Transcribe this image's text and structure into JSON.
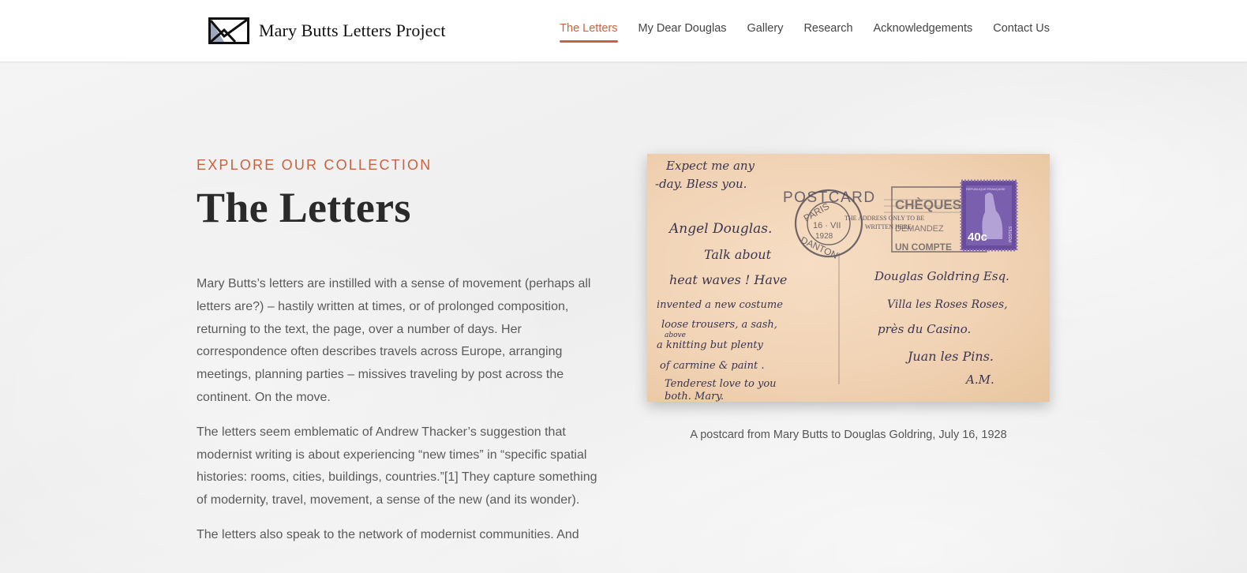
{
  "site": {
    "title": "Mary Butts Letters Project"
  },
  "nav": {
    "items": [
      {
        "label": "The Letters",
        "active": true
      },
      {
        "label": "My Dear Douglas",
        "active": false
      },
      {
        "label": "Gallery",
        "active": false
      },
      {
        "label": "Research",
        "active": false
      },
      {
        "label": "Acknowledgements",
        "active": false
      },
      {
        "label": "Contact Us",
        "active": false
      }
    ]
  },
  "hero": {
    "eyebrow": "EXPLORE OUR COLLECTION",
    "title": "The Letters",
    "paragraphs": [
      "Mary Butts’s letters are instilled with a sense of movement (perhaps all letters are?) – hastily written at times, or of prolonged composition, returning to the text, the page, over a number of days. Her correspondence often describes travels across Europe, arranging meetings, planning parties – missives traveling by post across the continent. On the move.",
      "The letters seem emblematic of Andrew Thacker’s suggestion that modernist writing is about experiencing “new times” in “specific spatial histories: rooms, cities, buildings, countries.”[1] They capture something of modernity, travel, movement, a sense of the new (and its wonder).",
      "The letters also speak to the network of modernist communities. And"
    ]
  },
  "figure": {
    "caption": "A postcard from Mary Butts to Douglas Goldring, July 16, 1928",
    "postcard": {
      "header": "POSTCARD",
      "address_note_1": "THE ADDRESS ONLY TO BE",
      "address_note_2": "WRITTEN HERE",
      "postmark_city": "PARIS",
      "postmark_branch": "DANTON",
      "postmark_date": "16 · VII",
      "postmark_year": "1928",
      "cancel_text_1": "CHÈQUES P",
      "cancel_text_2": "DEMANDEZ",
      "cancel_text_3": "UN COMPTE",
      "stamp_value": "40c",
      "stamp_top": "RÉPUBLIQUE FRANÇAISE",
      "stamp_side": "POSTES",
      "handwriting_left": [
        "Expect me any",
        "-day. Bless you.",
        "Angel Douglas.",
        "Talk about",
        "heat waves ! Have",
        "invented a new costume",
        "loose trousers, a sash,",
        "above",
        "a knitting but plenty",
        "of carmine & paint .",
        "Tenderest love to you",
        "both. Mary."
      ],
      "handwriting_right": [
        "Douglas Goldring Esq.",
        "Villa les Roses Roses,",
        "près du Casino.",
        "Juan les Pins.",
        "A.M."
      ],
      "colors": {
        "paper": "#f2d6b8",
        "ink": "#3a3550",
        "stamp": "#6a4c9c"
      }
    }
  },
  "colors": {
    "accent": "#c8623f",
    "heading": "#2a2a2a",
    "body_text": "#5a5a5a"
  }
}
